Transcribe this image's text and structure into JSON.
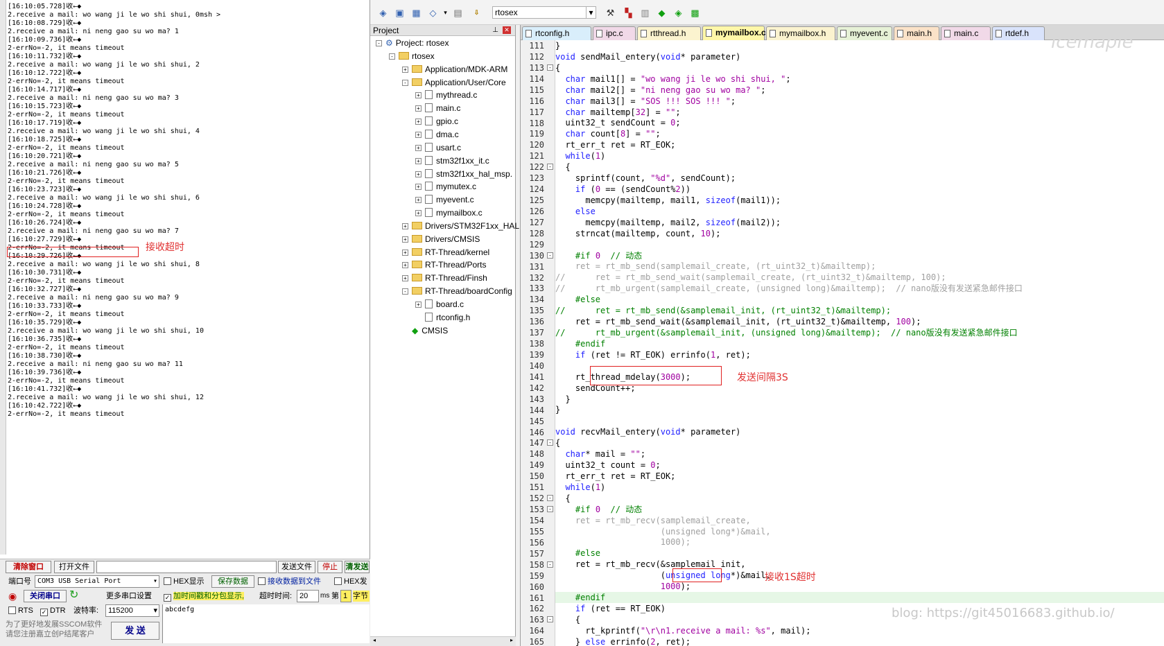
{
  "serial": {
    "log": [
      "[16:10:05.728]收←◆",
      "2.receive a mail: wo wang ji le wo shi shui, 0msh >",
      "[16:10:08.729]收←◆",
      "2.receive a mail: ni neng gao su wo ma? 1",
      "[16:10:09.736]收←◆",
      "2-errNo=-2, it means timeout",
      "[16:10:11.732]收←◆",
      "2.receive a mail: wo wang ji le wo shi shui, 2",
      "[16:10:12.722]收←◆",
      "2-errNo=-2, it means timeout",
      "[16:10:14.717]收←◆",
      "2.receive a mail: ni neng gao su wo ma? 3",
      "[16:10:15.723]收←◆",
      "2-errNo=-2, it means timeout",
      "[16:10:17.719]收←◆",
      "2.receive a mail: wo wang ji le wo shi shui, 4",
      "[16:10:18.725]收←◆",
      "2-errNo=-2, it means timeout",
      "[16:10:20.721]收←◆",
      "2.receive a mail: ni neng gao su wo ma? 5",
      "[16:10:21.726]收←◆",
      "2-errNo=-2, it means timeout",
      "[16:10:23.723]收←◆",
      "2.receive a mail: wo wang ji le wo shi shui, 6",
      "[16:10:24.728]收←◆",
      "2-errNo=-2, it means timeout",
      "[16:10:26.724]收←◆",
      "2.receive a mail: ni neng gao su wo ma? 7",
      "[16:10:27.729]收←◆",
      "2-errNo=-2, it means timeout",
      "[16:10:29.726]收←◆",
      "2.receive a mail: wo wang ji le wo shi shui, 8",
      "[16:10:30.731]收←◆",
      "2-errNo=-2, it means timeout",
      "[16:10:32.727]收←◆",
      "2.receive a mail: ni neng gao su wo ma? 9",
      "[16:10:33.733]收←◆",
      "2-errNo=-2, it means timeout",
      "[16:10:35.729]收←◆",
      "2.receive a mail: wo wang ji le wo shi shui, 10",
      "[16:10:36.735]收←◆",
      "2-errNo=-2, it means timeout",
      "[16:10:38.730]收←◆",
      "2.receive a mail: ni neng gao su wo ma? 11",
      "[16:10:39.736]收←◆",
      "2-errNo=-2, it means timeout",
      "[16:10:41.732]收←◆",
      "2.receive a mail: wo wang ji le wo shi shui, 12",
      "[16:10:42.722]收←◆",
      "2-errNo=-2, it means timeout"
    ],
    "annotation_recv_timeout": "接收超时",
    "clear_window": "清除窗口",
    "open_file": "打开文件",
    "file_path": "",
    "send_file": "发送文件",
    "stop": "停止",
    "clear_send": "清发送",
    "port_label": "端口号",
    "port_value": "COM3 USB Serial Port",
    "hex_display": "HEX显示",
    "save_data": "保存数据",
    "recv_to_file": "接收数据到文件",
    "hex_send": "HEX发",
    "close_port": "关闭串口",
    "more_ports": "更多串口设置",
    "timestamp_label": "加时间戳和分包显示,",
    "timeout_label": "超时时间:",
    "timeout_value": "20",
    "ms": "ms",
    "nth": "第",
    "byte_value": "1",
    "byte_unit": "字节",
    "rts": "RTS",
    "dtr": "DTR",
    "baud_label": "波特率:",
    "baud_value": "115200",
    "send_text": "abcdefg",
    "promo1": "为了更好地发展SSCOM软件",
    "promo2": "请您注册嘉立创P结尾客户",
    "send_button": "发 送"
  },
  "ide": {
    "target": "rtosex",
    "project_header": "Project",
    "tree": [
      {
        "label": "Project: rtosex",
        "level": 0,
        "kind": "root",
        "exp": "-"
      },
      {
        "label": "rtosex",
        "level": 1,
        "kind": "target",
        "exp": "-"
      },
      {
        "label": "Application/MDK-ARM",
        "level": 2,
        "kind": "folder",
        "exp": "+"
      },
      {
        "label": "Application/User/Core",
        "level": 2,
        "kind": "folder",
        "exp": "-"
      },
      {
        "label": "mythread.c",
        "level": 3,
        "kind": "file",
        "exp": "+"
      },
      {
        "label": "main.c",
        "level": 3,
        "kind": "file",
        "exp": "+"
      },
      {
        "label": "gpio.c",
        "level": 3,
        "kind": "file",
        "exp": "+"
      },
      {
        "label": "dma.c",
        "level": 3,
        "kind": "file",
        "exp": "+"
      },
      {
        "label": "usart.c",
        "level": 3,
        "kind": "file",
        "exp": "+"
      },
      {
        "label": "stm32f1xx_it.c",
        "level": 3,
        "kind": "file",
        "exp": "+"
      },
      {
        "label": "stm32f1xx_hal_msp.",
        "level": 3,
        "kind": "file",
        "exp": "+"
      },
      {
        "label": "mymutex.c",
        "level": 3,
        "kind": "file",
        "exp": "+"
      },
      {
        "label": "myevent.c",
        "level": 3,
        "kind": "file",
        "exp": "+"
      },
      {
        "label": "mymailbox.c",
        "level": 3,
        "kind": "file",
        "exp": "+"
      },
      {
        "label": "Drivers/STM32F1xx_HAL",
        "level": 2,
        "kind": "folder",
        "exp": "+"
      },
      {
        "label": "Drivers/CMSIS",
        "level": 2,
        "kind": "folder",
        "exp": "+"
      },
      {
        "label": "RT-Thread/kernel",
        "level": 2,
        "kind": "folder",
        "exp": "+"
      },
      {
        "label": "RT-Thread/Ports",
        "level": 2,
        "kind": "folder",
        "exp": "+"
      },
      {
        "label": "RT-Thread/Finsh",
        "level": 2,
        "kind": "folder",
        "exp": "+"
      },
      {
        "label": "RT-Thread/boardConfig",
        "level": 2,
        "kind": "folder",
        "exp": "-"
      },
      {
        "label": "board.c",
        "level": 3,
        "kind": "file",
        "exp": "+"
      },
      {
        "label": "rtconfig.h",
        "level": 3,
        "kind": "file",
        "exp": ""
      },
      {
        "label": "CMSIS",
        "level": 2,
        "kind": "gem",
        "exp": ""
      }
    ],
    "tabs": [
      {
        "label": "rtconfig.h",
        "color": "#d9eefb"
      },
      {
        "label": "ipc.c",
        "color": "#f1d9e8"
      },
      {
        "label": "rtthread.h",
        "color": "#fbf3cf"
      },
      {
        "label": "mymailbox.c",
        "color": "#fff7a8",
        "active": true
      },
      {
        "label": "mymailbox.h",
        "color": "#fbf3cf"
      },
      {
        "label": "myevent.c",
        "color": "#e6f1d6"
      },
      {
        "label": "main.h",
        "color": "#fbe2c8"
      },
      {
        "label": "main.c",
        "color": "#f1d9e8"
      },
      {
        "label": "rtdef.h",
        "color": "#d9e3fb"
      }
    ],
    "code": [
      {
        "n": 111,
        "t": "}"
      },
      {
        "n": 112,
        "t": "void sendMail_entery(void* parameter)"
      },
      {
        "n": 113,
        "t": "{",
        "fold": "-"
      },
      {
        "n": 114,
        "t": "  char mail1[] = \"wo wang ji le wo shi shui, \";"
      },
      {
        "n": 115,
        "t": "  char mail2[] = \"ni neng gao su wo ma? \";"
      },
      {
        "n": 116,
        "t": "  char mail3[] = \"SOS !!! SOS !!! \";"
      },
      {
        "n": 117,
        "t": "  char mailtemp[32] = \"\";"
      },
      {
        "n": 118,
        "t": "  uint32_t sendCount = 0;"
      },
      {
        "n": 119,
        "t": "  char count[8] = \"\";"
      },
      {
        "n": 120,
        "t": "  rt_err_t ret = RT_EOK;"
      },
      {
        "n": 121,
        "t": "  while(1)"
      },
      {
        "n": 122,
        "t": "  {",
        "fold": "-"
      },
      {
        "n": 123,
        "t": "    sprintf(count, \"%d\", sendCount);"
      },
      {
        "n": 124,
        "t": "    if (0 == (sendCount%2))"
      },
      {
        "n": 125,
        "t": "      memcpy(mailtemp, mail1, sizeof(mail1));"
      },
      {
        "n": 126,
        "t": "    else"
      },
      {
        "n": 127,
        "t": "      memcpy(mailtemp, mail2, sizeof(mail2));"
      },
      {
        "n": 128,
        "t": "    strncat(mailtemp, count, 10);"
      },
      {
        "n": 129,
        "t": ""
      },
      {
        "n": 130,
        "t": "    #if 0  // 动态",
        "fold": "-"
      },
      {
        "n": 131,
        "t": "    ret = rt_mb_send(samplemail_create, (rt_uint32_t)&mailtemp);",
        "dim": true
      },
      {
        "n": 132,
        "t": "//      ret = rt_mb_send_wait(samplemail_create, (rt_uint32_t)&mailtemp, 100);",
        "dim": true
      },
      {
        "n": 133,
        "t": "//      rt_mb_urgent(samplemail_create, (unsigned long)&mailtemp);  // nano版没有发送紧急邮件接口",
        "dim": true
      },
      {
        "n": 134,
        "t": "    #else"
      },
      {
        "n": 135,
        "t": "//      ret = rt_mb_send(&samplemail_init, (rt_uint32_t)&mailtemp);"
      },
      {
        "n": 136,
        "t": "    ret = rt_mb_send_wait(&samplemail_init, (rt_uint32_t)&mailtemp, 100);"
      },
      {
        "n": 137,
        "t": "//      rt_mb_urgent(&samplemail_init, (unsigned long)&mailtemp);  // nano版没有发送紧急邮件接口"
      },
      {
        "n": 138,
        "t": "    #endif"
      },
      {
        "n": 139,
        "t": "    if (ret != RT_EOK) errinfo(1, ret);"
      },
      {
        "n": 140,
        "t": ""
      },
      {
        "n": 141,
        "t": "    rt_thread_mdelay(3000);"
      },
      {
        "n": 142,
        "t": "    sendCount++;"
      },
      {
        "n": 143,
        "t": "  }"
      },
      {
        "n": 144,
        "t": "}"
      },
      {
        "n": 145,
        "t": ""
      },
      {
        "n": 146,
        "t": "void recvMail_entery(void* parameter)"
      },
      {
        "n": 147,
        "t": "{",
        "fold": "-"
      },
      {
        "n": 148,
        "t": "  char* mail = \"\";"
      },
      {
        "n": 149,
        "t": "  uint32_t count = 0;"
      },
      {
        "n": 150,
        "t": "  rt_err_t ret = RT_EOK;"
      },
      {
        "n": 151,
        "t": "  while(1)"
      },
      {
        "n": 152,
        "t": "  {",
        "fold": "-"
      },
      {
        "n": 153,
        "t": "    #if 0  // 动态",
        "fold": "-"
      },
      {
        "n": 154,
        "t": "    ret = rt_mb_recv(samplemail_create,",
        "dim": true
      },
      {
        "n": 155,
        "t": "                     (unsigned long*)&mail,",
        "dim": true
      },
      {
        "n": 156,
        "t": "                     1000);",
        "dim": true
      },
      {
        "n": 157,
        "t": "    #else"
      },
      {
        "n": 158,
        "t": "    ret = rt_mb_recv(&samplemail_init,",
        "fold": "-"
      },
      {
        "n": 159,
        "t": "                     (unsigned long*)&mail,"
      },
      {
        "n": 160,
        "t": "                     1000);"
      },
      {
        "n": 161,
        "t": "    #endif"
      },
      {
        "n": 162,
        "t": "    if (ret == RT_EOK)"
      },
      {
        "n": 163,
        "t": "    {",
        "fold": "-"
      },
      {
        "n": 164,
        "t": "      rt_kprintf(\"\\r\\n1.receive a mail: %s\", mail);"
      },
      {
        "n": 165,
        "t": "    } else errinfo(2, ret);"
      }
    ],
    "annotation_send_interval": "发送间隔3S",
    "annotation_recv_timeout_1s": "接收1S超时"
  },
  "watermark": "blog: https://git45016683.github.io/",
  "watermark_logo": "icemaple"
}
